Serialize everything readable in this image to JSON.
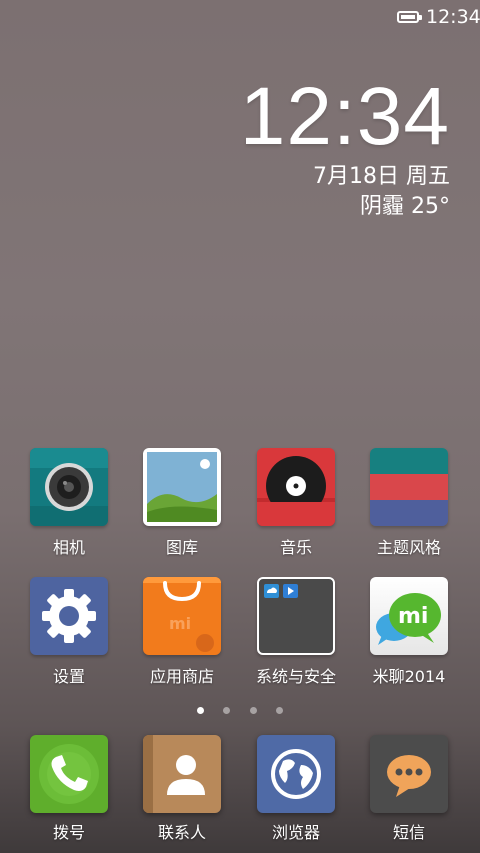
{
  "status_bar": {
    "time": "12:34",
    "battery_icon": "battery-full-icon"
  },
  "widget": {
    "time": "12:34",
    "date": "7月18日 周五",
    "weather": "阴霾 25°"
  },
  "apps_row1": [
    {
      "label": "相机",
      "icon": "camera-icon"
    },
    {
      "label": "图库",
      "icon": "gallery-icon"
    },
    {
      "label": "音乐",
      "icon": "music-icon"
    },
    {
      "label": "主题风格",
      "icon": "theme-icon"
    }
  ],
  "apps_row2": [
    {
      "label": "设置",
      "icon": "gear-icon"
    },
    {
      "label": "应用商店",
      "icon": "store-bag-icon"
    },
    {
      "label": "系统与安全",
      "icon": "folder-icon"
    },
    {
      "label": "米聊2014",
      "icon": "miliao-icon"
    }
  ],
  "pages": {
    "count": 4,
    "active": 1
  },
  "dock": [
    {
      "label": "拨号",
      "icon": "phone-icon"
    },
    {
      "label": "联系人",
      "icon": "contacts-icon"
    },
    {
      "label": "浏览器",
      "icon": "globe-icon"
    },
    {
      "label": "短信",
      "icon": "message-icon"
    }
  ],
  "colors": {
    "camera": "#137a7f",
    "music_red": "#d9383b",
    "theme_teal": "#178080",
    "settings": "#4e64a0",
    "store": "#f27b1c",
    "phone": "#5fae2c",
    "contacts": "#b8895a",
    "browser": "#4f6aa6",
    "sms": "#4c4c4c"
  }
}
